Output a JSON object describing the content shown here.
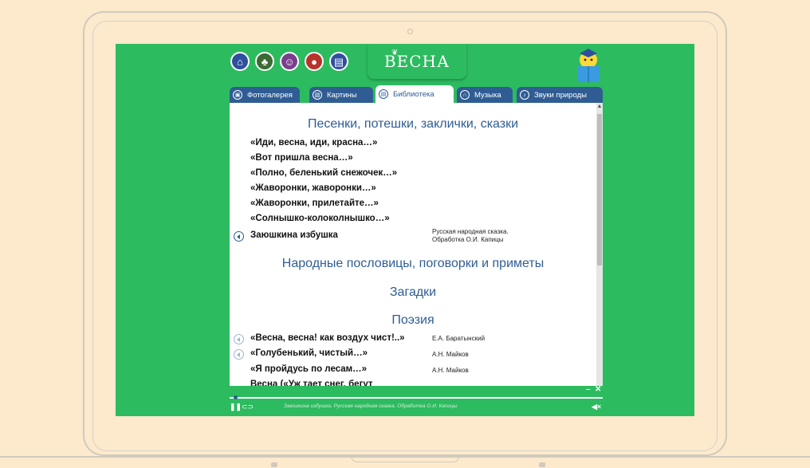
{
  "app": {
    "logo_text": "ВЕСНА"
  },
  "nav_icons": [
    "home-icon",
    "tree-icon",
    "family-icon",
    "bird-icon",
    "book-icon"
  ],
  "tabs": [
    {
      "label": "Фотогалерея",
      "icon": "photo-icon",
      "active": false
    },
    {
      "label": "Картины",
      "icon": "picture-icon",
      "active": false
    },
    {
      "label": "Библиотека",
      "icon": "library-icon",
      "active": true
    },
    {
      "label": "Музыка",
      "icon": "headphones-icon",
      "active": false
    },
    {
      "label": "Звуки природы",
      "icon": "nature-sound-icon",
      "active": false
    }
  ],
  "library": {
    "section_songs": "Песенки, потешки, заклички, сказки",
    "songs": [
      "«Иди, весна, иди, красна…»",
      "«Вот пришла весна…»",
      "«Полно, беленький снежочек…»",
      "«Жаворонки, жаворонки…»",
      "«Жаворонки, прилетайте…»",
      "«Солнышко-колоколнышко…»"
    ],
    "tale": {
      "title": "Заюшкина избушка",
      "author_line1": "Русская народная сказка.",
      "author_line2": "Обработка О.И. Капицы"
    },
    "section_proverbs": "Народные пословицы, поговорки и приметы",
    "section_riddles": "Загадки",
    "section_poetry": "Поэзия",
    "poems": [
      {
        "title": "«Весна, весна! как воздух чист!..»",
        "author": "Е.А. Баратынский"
      },
      {
        "title": "«Голубенький, чистый…»",
        "author": "А.Н. Майков"
      },
      {
        "title": "«Я пройдусь по лесам…»",
        "author": "А.Н. Майков"
      },
      {
        "title": "Весна («Уж тает снег, бегут",
        "author": ""
      }
    ]
  },
  "player": {
    "caption": "Заюшкина избушка. Русская народная сказка. Обработка О.И. Капицы",
    "pause_icon": "pause-icon",
    "loop_icon": "loop-icon",
    "mute_icon": "mute-icon",
    "minimize_icon": "minimize-icon",
    "close_icon": "close-icon",
    "progress": 0.01
  },
  "colors": {
    "green": "#2dbb5f",
    "blue": "#2f5d93",
    "background": "#fde9cc"
  }
}
